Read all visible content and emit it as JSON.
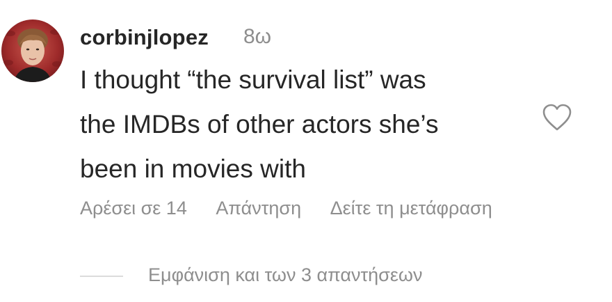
{
  "comment": {
    "username": "corbinjlopez",
    "time": "8ω",
    "text": "I thought “the survival list” was\nthe IMDBs of other actors she’s\nbeen in movies with",
    "avatar_icon": "user-avatar-photo",
    "like_icon": "heart-outline-icon"
  },
  "actions": {
    "likes": "Αρέσει σε 14",
    "reply": "Απάντηση",
    "translate": "Δείτε τη μετάφραση"
  },
  "replies": {
    "view_label": "Εμφάνιση και των 3 απαντήσεων"
  },
  "colors": {
    "text": "#262626",
    "secondary": "#8e8e8e",
    "divider": "#dbdbdb",
    "avatar_bg": "#9e2a2a"
  }
}
